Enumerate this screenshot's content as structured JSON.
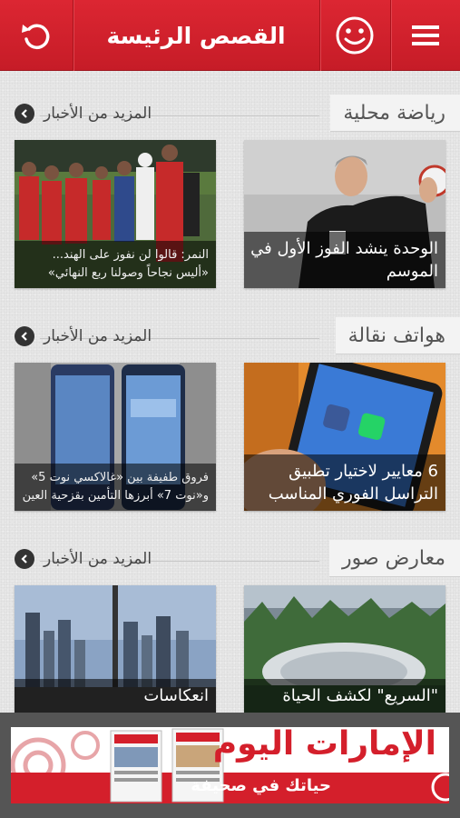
{
  "header": {
    "title": "القصص الرئيسة",
    "menu_icon": "hamburger-menu-icon",
    "smiley_icon": "smiley-icon",
    "refresh_icon": "refresh-icon",
    "color": "#d0222d"
  },
  "sections": [
    {
      "title": "رياضة محلية",
      "more_label": "المزيد من الأخبار",
      "cards": [
        {
          "caption": "الوحدة ينشد الفوز الأول في الموسم"
        },
        {
          "caption": "النمر: قالوا لن نفوز على الهند... «أليس نجاحاً وصولنا ربع النهائي»"
        }
      ]
    },
    {
      "title": "هواتف نقالة",
      "more_label": "المزيد من الأخبار",
      "cards": [
        {
          "caption": "6 معايير لاختيار تطبيق التراسل الفوري المناسب"
        },
        {
          "caption": "فروق طفيفة بين «غالاكسي نوت 5» و«نوت 7» أبرزها التأمين بقزحية العين"
        }
      ]
    },
    {
      "title": "معارض صور",
      "more_label": "المزيد من الأخبار",
      "cards": [
        {
          "caption": "\"السريع\" لكشف الحياة"
        },
        {
          "caption": "انعكاسات"
        }
      ]
    }
  ],
  "ad": {
    "brand": "الإمارات اليوم",
    "slogan": "حياتك في صحيفة",
    "color": "#d41f2b"
  }
}
